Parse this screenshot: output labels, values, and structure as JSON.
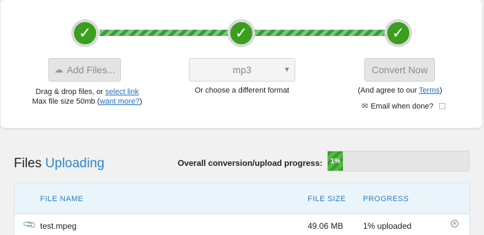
{
  "steps": {
    "step1_icon": "checkmark-icon",
    "step2_icon": "checkmark-icon",
    "step3_icon": "checkmark-icon",
    "check_glyph": "✓"
  },
  "upload": {
    "add_files_label": "Add Files...",
    "add_files_icon": "cloud-upload-icon",
    "drag_text": "Drag & drop files, or ",
    "select_link": "select link",
    "max_size_text": "Max file size 50mb (",
    "want_more_link": "want more?",
    "max_size_close": ")"
  },
  "format": {
    "selected": "mp3",
    "helper_text": "Or choose a different format"
  },
  "convert": {
    "button_label": "Convert Now",
    "agree_prefix": "(And agree to our ",
    "terms_link": "Terms",
    "agree_suffix": ")",
    "email_label": "Email when done?",
    "email_icon": "envelope-icon",
    "email_checked": false
  },
  "files": {
    "title_plain": "Files",
    "title_accent": "Uploading",
    "overall_label": "Overall conversion/upload progress:",
    "overall_progress_text": "1%",
    "overall_progress_fraction": 0.01,
    "columns": {
      "name": "FILE NAME",
      "size": "FILE SIZE",
      "progress": "PROGRESS"
    },
    "rows": [
      {
        "icon": "paperclip-icon",
        "name": "test.mpeg",
        "size": "49.06 MB",
        "progress": "1% uploaded",
        "remove_icon": "close-circle-icon"
      }
    ]
  },
  "colors": {
    "green": "#3a9e1f",
    "accent_blue": "#2e86c9",
    "link_blue": "#1f6fbf"
  }
}
